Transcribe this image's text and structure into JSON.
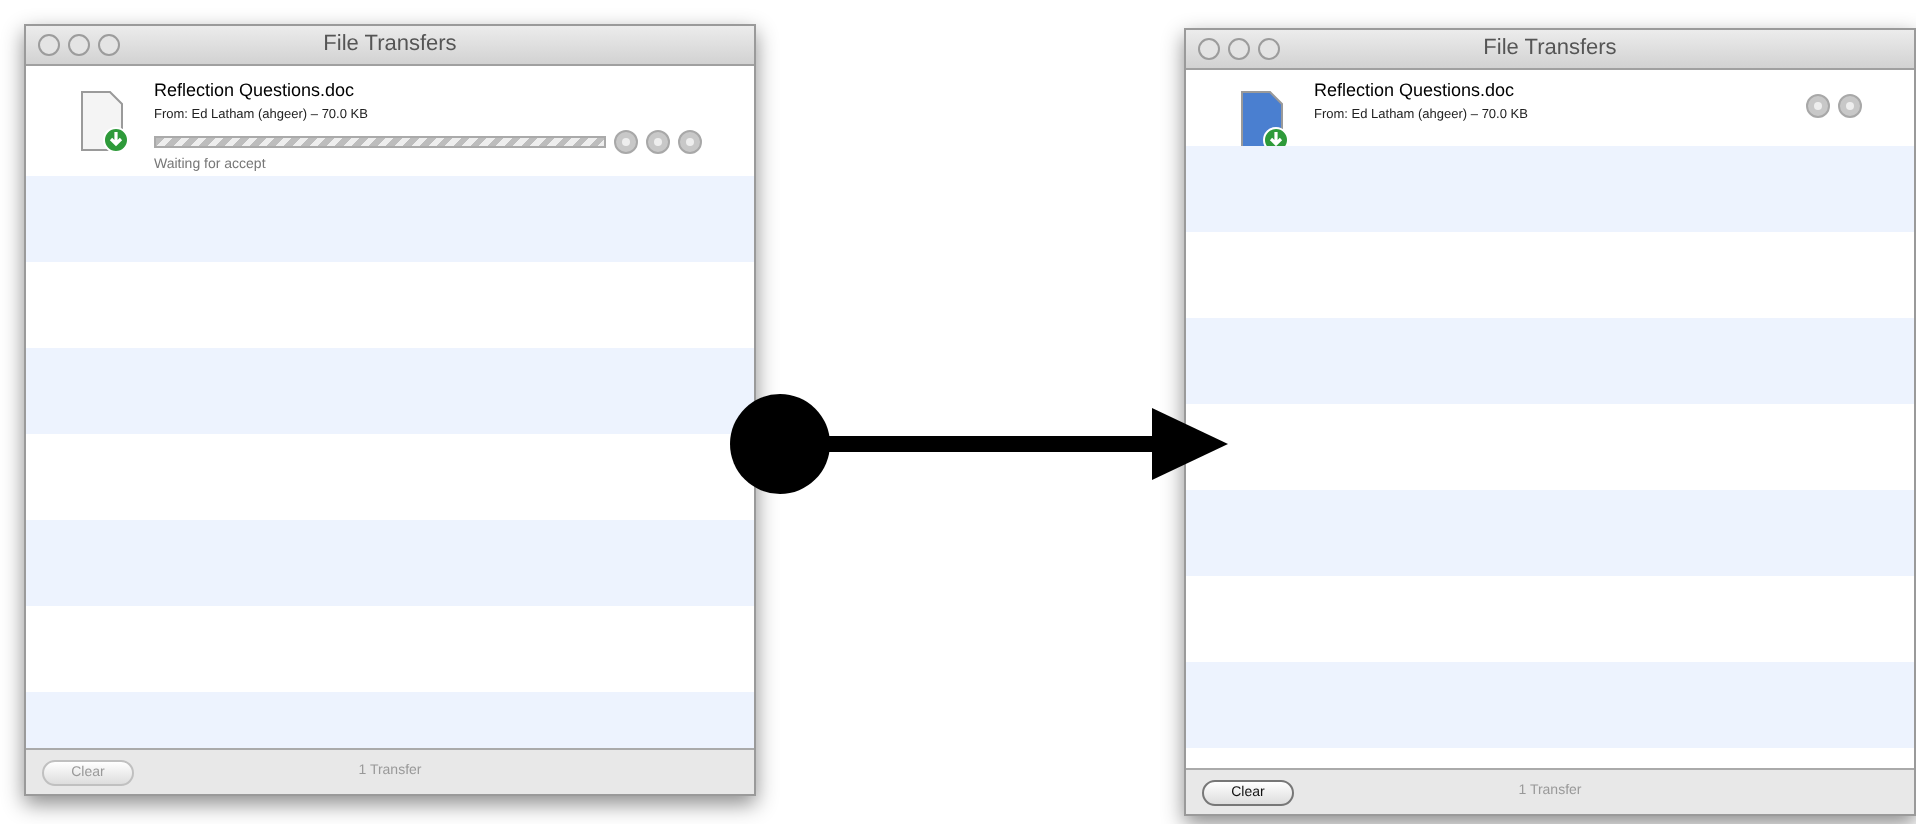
{
  "windows": [
    {
      "title": "File Transfers",
      "transfer": {
        "kind": "pending",
        "file_name": "Reflection Questions.doc",
        "from": "From: Ed Latham (ahgeer) – 70.0 KB",
        "status": "Waiting for accept",
        "indeterminate": true
      },
      "clear": {
        "label": "Clear",
        "disabled": true
      },
      "status_text": "1 Transfer"
    },
    {
      "title": "File Transfers",
      "transfer": {
        "kind": "received",
        "file_name": "Reflection Questions.doc",
        "from": "From: Ed Latham (ahgeer) – 70.0 KB"
      },
      "clear": {
        "label": "Clear",
        "disabled": false
      },
      "status_text": "1 Transfer"
    }
  ]
}
